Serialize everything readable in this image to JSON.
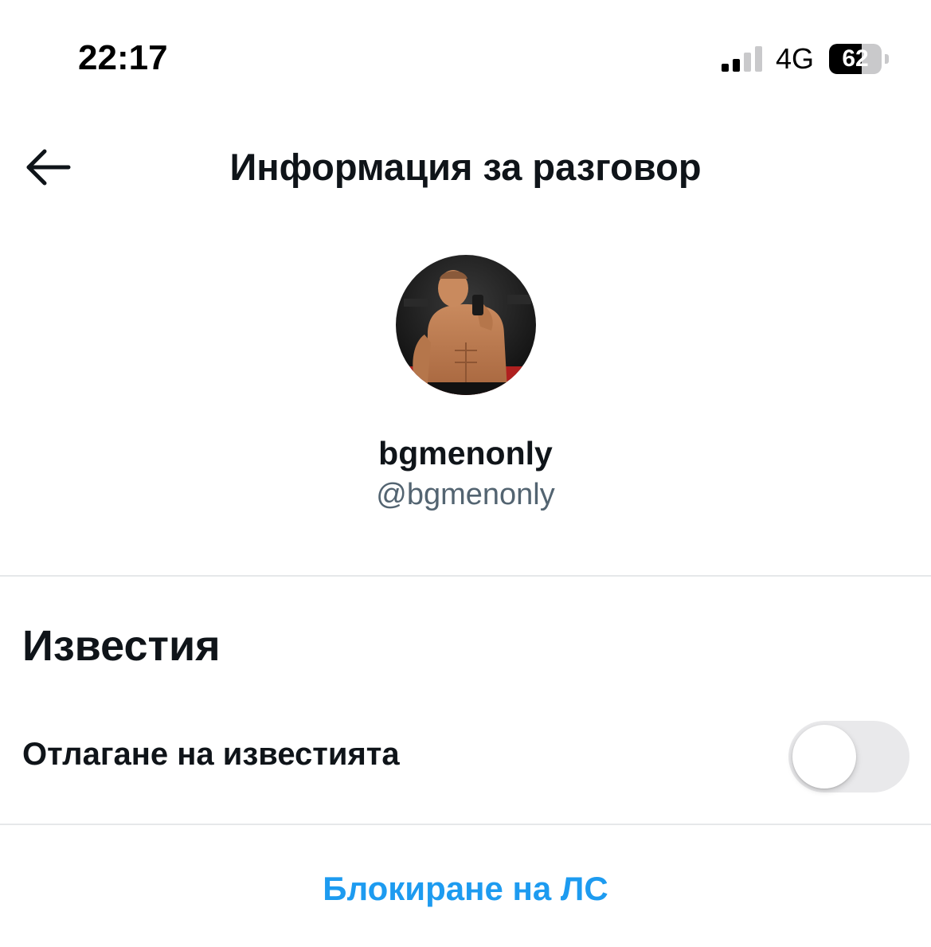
{
  "status_bar": {
    "time": "22:17",
    "network": "4G",
    "battery_level": "62",
    "signal_strength_bars": 2,
    "signal_total_bars": 4
  },
  "header": {
    "back_icon": "arrow-left-icon",
    "title": "Информация за разговор"
  },
  "profile": {
    "display_name": "bgmenonly",
    "handle": "@bgmenonly"
  },
  "notifications": {
    "heading": "Известия",
    "snooze_label": "Отлагане на известията",
    "snooze_enabled": false
  },
  "actions": {
    "block_label": "Блокиране на ЛС"
  },
  "colors": {
    "text_primary": "#0f1419",
    "text_secondary": "#536471",
    "accent": "#1d9bf0",
    "divider": "#e6e8ea",
    "toggle_off": "#e9e9eb"
  }
}
